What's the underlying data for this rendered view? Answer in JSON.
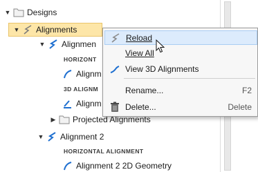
{
  "tree": {
    "designs": "Designs",
    "alignments": "Alignments",
    "alignment1_partial": "Alignmen",
    "horizont_partial": "HORIZONT",
    "alignment_item_a": "Alignm",
    "align3d_partial": "3D ALIGNM",
    "alignment_item_b": "Alignm",
    "projected_alignments": "Projected Alignments",
    "alignment2": "Alignment 2",
    "horizontal_alignment": "HORIZONTAL ALIGNMENT",
    "alignment2_2d": "Alignment 2 2D Geometry"
  },
  "context_menu": {
    "reload": "Reload",
    "view_all": "View All",
    "view_3d": "View 3D Alignments",
    "rename": "Rename...",
    "rename_shortcut": "F2",
    "delete": "Delete...",
    "delete_shortcut": "Delete"
  },
  "colors": {
    "selection_bg": "#fde6a8",
    "menu_hover": "#dcebfc",
    "alignment_icon_blue": "#1e6fd0",
    "folder_icon": "#e3c567"
  }
}
